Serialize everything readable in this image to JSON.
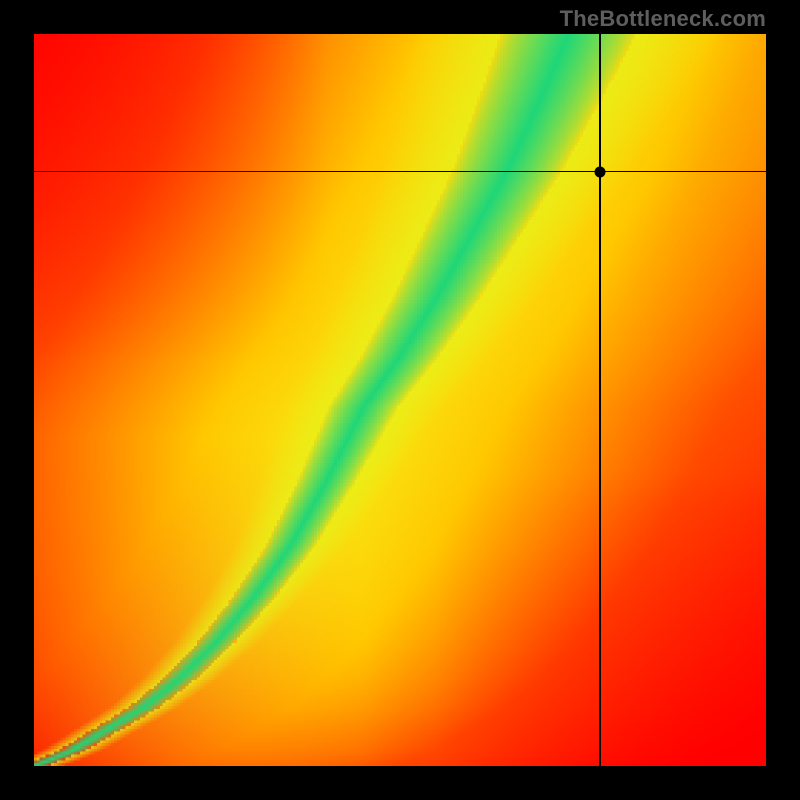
{
  "attribution_text": "TheBottleneck.com",
  "chart_data": {
    "type": "heatmap",
    "title": "",
    "xlabel": "",
    "ylabel": "",
    "xlim": [
      0,
      1
    ],
    "ylim": [
      0,
      1
    ],
    "colormap_description": "red→orange→yellow→green gradient; green ridge marks optimal curve",
    "marker": {
      "x": 0.773,
      "y": 0.812
    },
    "optimal_curve_samples_xy": [
      [
        0.0,
        0.0
      ],
      [
        0.05,
        0.02
      ],
      [
        0.1,
        0.05
      ],
      [
        0.15,
        0.08
      ],
      [
        0.2,
        0.12
      ],
      [
        0.25,
        0.17
      ],
      [
        0.3,
        0.23
      ],
      [
        0.35,
        0.3
      ],
      [
        0.4,
        0.39
      ],
      [
        0.45,
        0.49
      ],
      [
        0.5,
        0.56
      ],
      [
        0.55,
        0.64
      ],
      [
        0.6,
        0.73
      ],
      [
        0.65,
        0.82
      ],
      [
        0.7,
        0.93
      ],
      [
        0.73,
        1.0
      ]
    ],
    "axes_visible": false,
    "grid": false
  },
  "heatmap_resolution": 256,
  "heatmap_params": {
    "corner_top_right_color": "#f1c232",
    "corner_bottom_left_color": "#ff0000",
    "corner_bottom_right_color": "#ff0000",
    "corner_top_left_color": "#ff0000",
    "mid_top_color": "#ffd000",
    "ridge_color": "#1ed68a",
    "ridge_halo_color": "#f8f000"
  }
}
